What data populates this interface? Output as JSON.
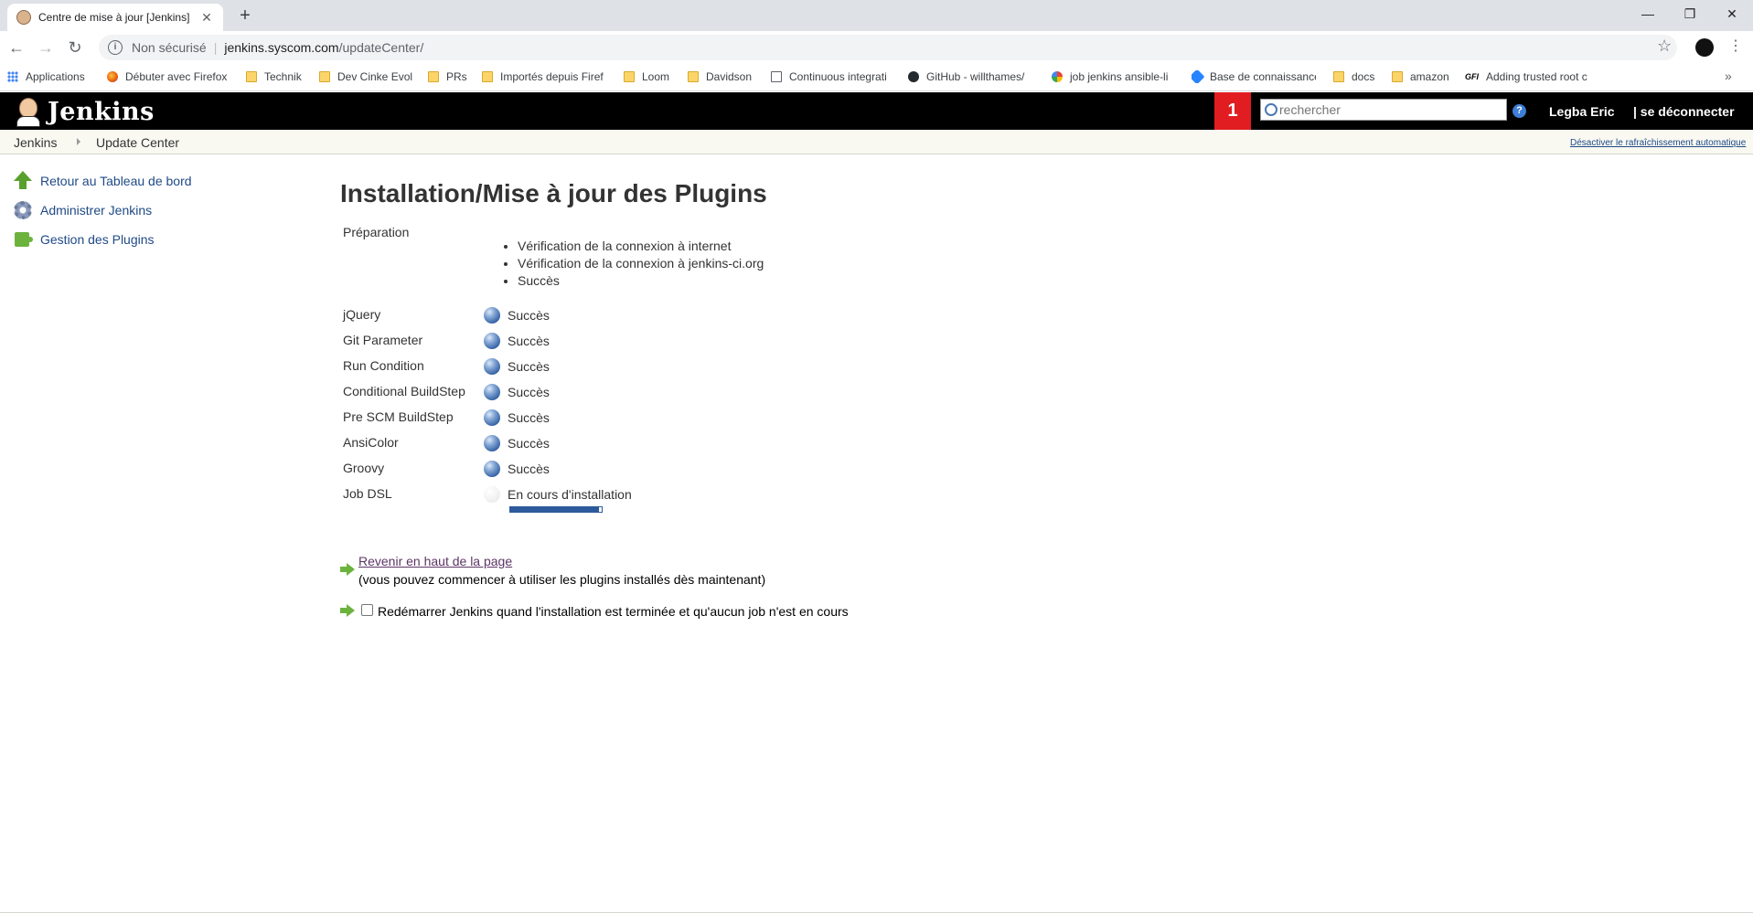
{
  "browser": {
    "tab_title": "Centre de mise à jour [Jenkins]",
    "tab_close": "✕",
    "new_tab": "+",
    "security_label": "Non sécurisé",
    "url_host": "jenkins.syscom.com",
    "url_path": "/updateCenter/",
    "bookmarks": [
      {
        "label": "Applications",
        "icon": "apps-icon"
      },
      {
        "label": "Débuter avec Firefox",
        "icon": "firefox-icon"
      },
      {
        "label": "Technik",
        "icon": "folder-icon"
      },
      {
        "label": "Dev Cinke Evol",
        "icon": "folder-icon"
      },
      {
        "label": "PRs",
        "icon": "folder-icon"
      },
      {
        "label": "Importés depuis Firef",
        "icon": "folder-icon"
      },
      {
        "label": "Loom",
        "icon": "folder-icon"
      },
      {
        "label": "Davidson",
        "icon": "folder-icon"
      },
      {
        "label": "Continuous integrati",
        "icon": "page-icon"
      },
      {
        "label": "GitHub - willthames/",
        "icon": "github-icon"
      },
      {
        "label": "job jenkins ansible-li",
        "icon": "google-icon"
      },
      {
        "label": "Base de connaissance",
        "icon": "confluence-icon"
      },
      {
        "label": "docs",
        "icon": "folder-icon"
      },
      {
        "label": "amazon",
        "icon": "folder-icon"
      },
      {
        "label": "Adding trusted root c",
        "icon": "gfi-icon"
      }
    ],
    "gfi_mark": "GFI"
  },
  "jenkins": {
    "brand": "Jenkins",
    "notification_count": "1",
    "search_placeholder": "rechercher",
    "help": "?",
    "user": "Legba Eric",
    "logout": "| se déconnecter"
  },
  "breadcrumb": {
    "items": [
      "Jenkins",
      "Update Center"
    ],
    "auto_refresh": "Désactiver le rafraîchissement automatique"
  },
  "sidebar": {
    "items": [
      {
        "label": "Retour au Tableau de bord",
        "icon": "up-arrow-icon"
      },
      {
        "label": "Administrer Jenkins",
        "icon": "gear-icon"
      },
      {
        "label": "Gestion des Plugins",
        "icon": "puzzle-icon"
      }
    ]
  },
  "main": {
    "title": "Installation/Mise à jour des Plugins",
    "preparation": {
      "label": "Préparation",
      "steps": [
        "Vérification de la connexion à internet",
        "Vérification de la connexion à jenkins-ci.org",
        "Succès"
      ]
    },
    "plugins": [
      {
        "name": "jQuery",
        "status": "Succès",
        "state": "success"
      },
      {
        "name": "Git Parameter",
        "status": "Succès",
        "state": "success"
      },
      {
        "name": "Run Condition",
        "status": "Succès",
        "state": "success"
      },
      {
        "name": "Conditional BuildStep",
        "status": "Succès",
        "state": "success"
      },
      {
        "name": "Pre SCM BuildStep",
        "status": "Succès",
        "state": "success"
      },
      {
        "name": "AnsiColor",
        "status": "Succès",
        "state": "success"
      },
      {
        "name": "Groovy",
        "status": "Succès",
        "state": "success"
      },
      {
        "name": "Job DSL",
        "status": "En cours d'installation",
        "state": "installing",
        "progress": 0.97
      }
    ],
    "back_link": "Revenir en haut de la page",
    "back_note": "(vous pouvez commencer à utiliser les plugins installés dès maintenant)",
    "restart_label": "Redémarrer Jenkins quand l'installation est terminée et qu'aucun job n'est en cours",
    "restart_checked": false
  },
  "colors": {
    "header_bg": "#000000",
    "notification_bg": "#e11d21",
    "link": "#204a87",
    "visited_link": "#5c3566",
    "success_ball": "#2c5a9c",
    "arrow_green": "#6cb33e"
  }
}
